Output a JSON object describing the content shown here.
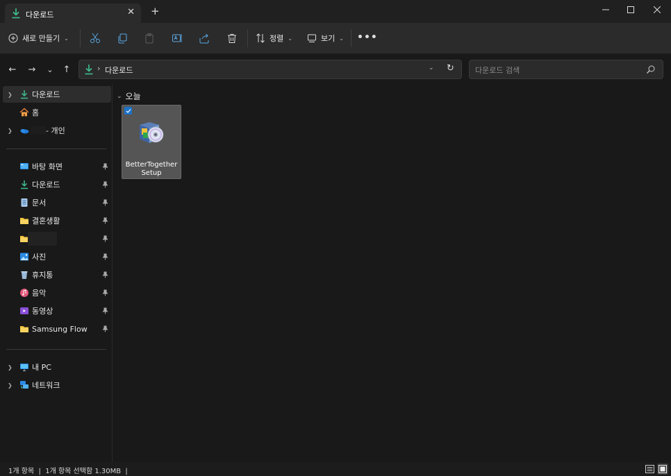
{
  "window": {
    "tab_title": "다운로드",
    "close_tab_glyph": "✕",
    "new_tab_glyph": "+",
    "minimize_glyph": "—",
    "maximize_glyph": "☐",
    "close_glyph": "✕"
  },
  "toolbar": {
    "new_label": "새로 만들기",
    "sort_label": "정렬",
    "view_label": "보기",
    "more_glyph": "•••",
    "icons": [
      "cut-icon",
      "copy-icon",
      "paste-icon",
      "rename-icon",
      "share-icon",
      "delete-icon"
    ]
  },
  "nav": {
    "back_glyph": "←",
    "forward_glyph": "→",
    "recent_glyph": "⌄",
    "up_glyph": "↑",
    "breadcrumb_separator": "›",
    "address": "다운로드",
    "refresh_glyph": "↻",
    "search_placeholder": "다운로드 검색"
  },
  "sidebar": {
    "top_items": [
      {
        "label": "다운로드",
        "icon": "download-icon",
        "expandable": true,
        "selected": true
      },
      {
        "label": "홈",
        "icon": "home-icon",
        "expandable": false,
        "selected": false
      },
      {
        "label": "- 개인",
        "icon": "onedrive-icon",
        "expandable": true,
        "selected": false
      }
    ],
    "quick_access": [
      {
        "label": "바탕 화면",
        "icon": "desktop-icon",
        "pinned": true
      },
      {
        "label": "다운로드",
        "icon": "download-icon",
        "pinned": true
      },
      {
        "label": "문서",
        "icon": "documents-icon",
        "pinned": true
      },
      {
        "label": "결혼생활",
        "icon": "folder-icon",
        "pinned": true
      },
      {
        "label": "",
        "icon": "folder-icon",
        "pinned": true
      },
      {
        "label": "사진",
        "icon": "pictures-icon",
        "pinned": true
      },
      {
        "label": "휴지통",
        "icon": "recycle-bin-icon",
        "pinned": true
      },
      {
        "label": "음악",
        "icon": "music-icon",
        "pinned": true
      },
      {
        "label": "동영상",
        "icon": "videos-icon",
        "pinned": true
      },
      {
        "label": "Samsung Flow",
        "icon": "folder-icon",
        "pinned": true
      }
    ],
    "bottom_items": [
      {
        "label": "내 PC",
        "icon": "this-pc-icon",
        "expandable": true
      },
      {
        "label": "네트워크",
        "icon": "network-icon",
        "expandable": true
      }
    ]
  },
  "content": {
    "group_header": "오늘",
    "files": [
      {
        "name": "BetterTogetherSetup",
        "icon": "installer-cd-icon",
        "selected": true
      }
    ]
  },
  "status": {
    "text": "1개 항목  |  1개 항목 선택함 1.30MB  |"
  },
  "colors": {
    "accent": "#1d73c9",
    "download_green": "#3fbf8f",
    "folder_yellow": "#f0c23a"
  }
}
